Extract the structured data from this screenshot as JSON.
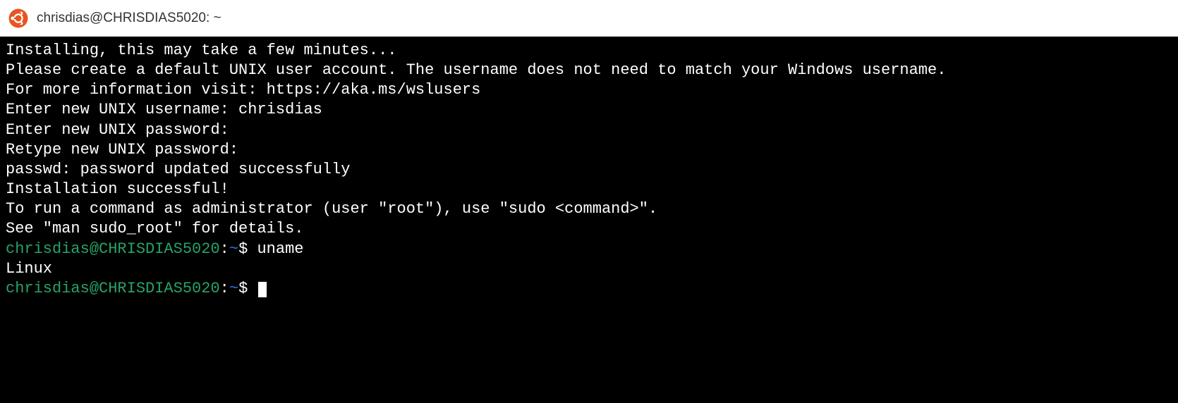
{
  "titlebar": {
    "icon": "ubuntu-icon",
    "title": "chrisdias@CHRISDIAS5020: ~"
  },
  "terminal": {
    "lines": [
      "Installing, this may take a few minutes...",
      "Please create a default UNIX user account. The username does not need to match your Windows username.",
      "For more information visit: https://aka.ms/wslusers",
      "Enter new UNIX username: chrisdias",
      "Enter new UNIX password:",
      "Retype new UNIX password:",
      "passwd: password updated successfully",
      "Installation successful!",
      "To run a command as administrator (user \"root\"), use \"sudo <command>\".",
      "See \"man sudo_root\" for details.",
      ""
    ],
    "prompt1": {
      "user_host": "chrisdias@CHRISDIAS5020",
      "colon": ":",
      "path": "~",
      "dollar": "$",
      "command": "uname"
    },
    "output1": "Linux",
    "prompt2": {
      "user_host": "chrisdias@CHRISDIAS5020",
      "colon": ":",
      "path": "~",
      "dollar": "$",
      "command": ""
    }
  }
}
